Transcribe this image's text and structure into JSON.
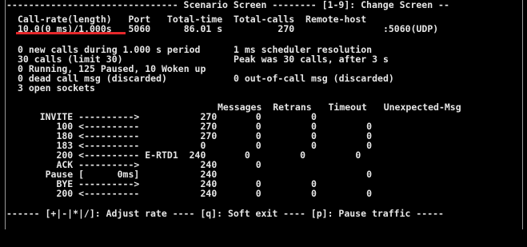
{
  "header": {
    "banner": "------------------------------- Scenario Screen -------- [1-9]: Change Screen --",
    "columns": "Call-rate(length)   Port   Total-time  Total-calls  Remote-host",
    "values": "10.0(0 ms)/1.000s   5060      86.01 s          270                :5060(UDP)"
  },
  "status": {
    "line1": "0 new calls during 1.000 s period      1 ms scheduler resolution",
    "line2": "30 calls (limit 30)                    Peak was 30 calls, after 3 s",
    "line3": "0 Running, 125 Paused, 10 Woken up",
    "line4": "0 dead call msg (discarded)            0 out-of-call msg (discarded)",
    "line5": "3 open sockets"
  },
  "table": {
    "header": "Messages  Retrans   Timeout   Unexpected-Msg",
    "rows": [
      "    INVITE ---------->           270       0         0",
      "       100 <----------           270       0         0         0",
      "       180 <----------           270       0         0         0",
      "       183 <----------           0         0         0         0",
      "       200 <---------- E-RTD1  240       0         0         0",
      "       ACK ---------->           240       0",
      "     Pause [      0ms]           240                           0",
      "       BYE ---------->           240       0         0",
      "       200 <----------           240       0         0         0"
    ]
  },
  "footer": {
    "keys": "------ [+|-|*|/]: Adjust rate ---- [q]: Soft exit ---- [p]: Pause traffic -----"
  },
  "colors": {
    "background": "#000000",
    "text": "#e6e6e6",
    "highlight_underline": "#e5282b"
  }
}
